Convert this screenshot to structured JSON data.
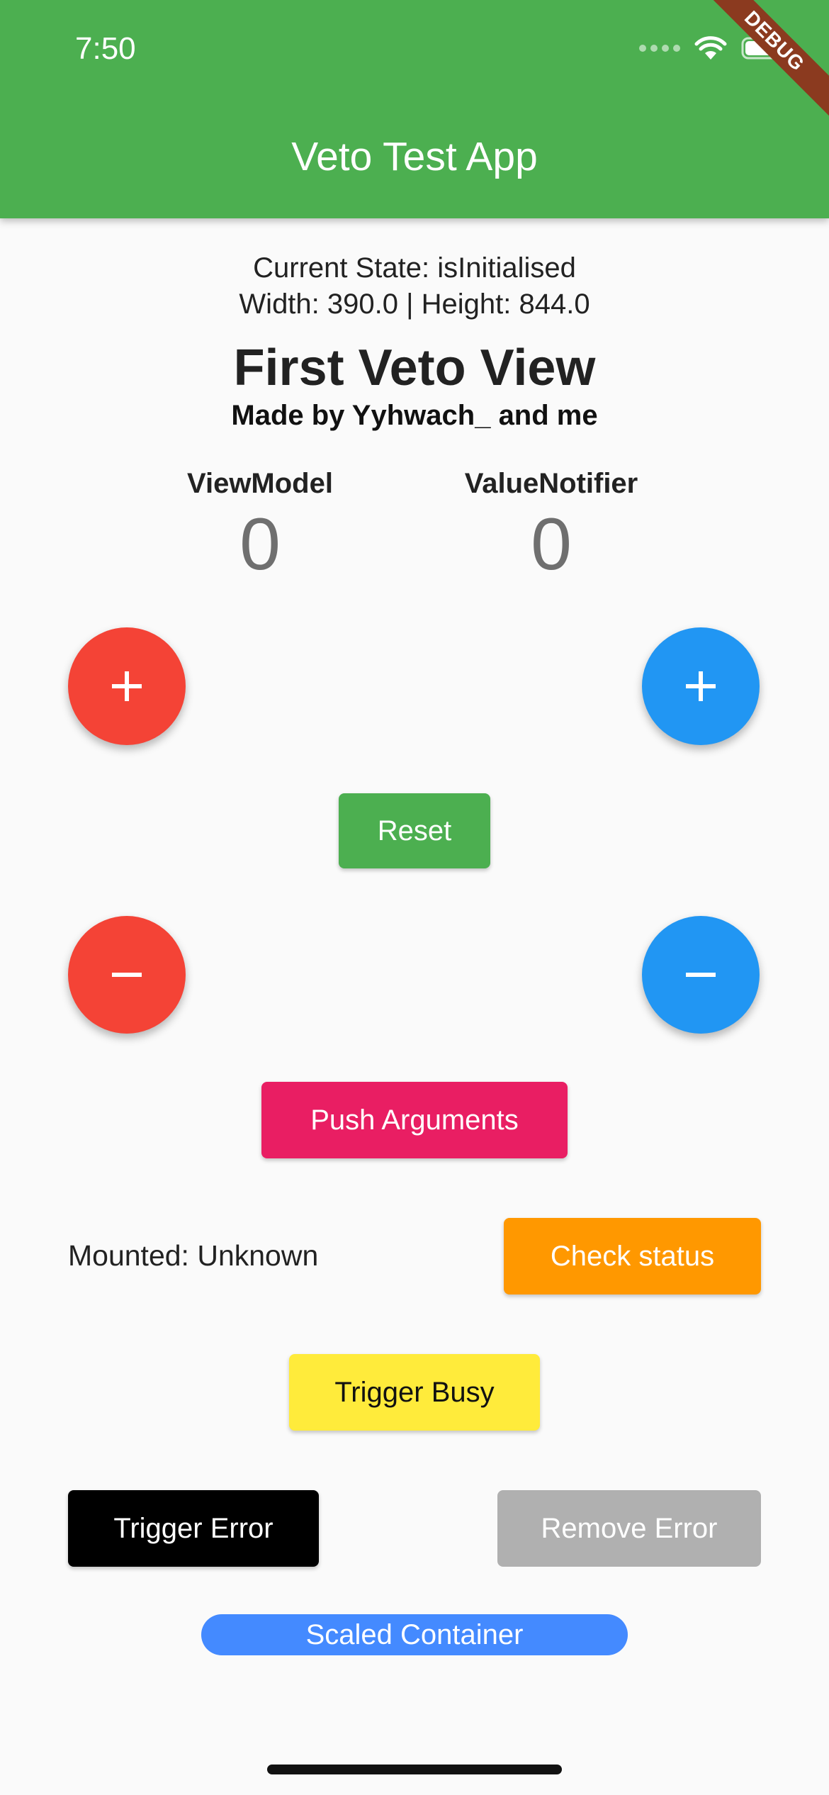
{
  "status_bar": {
    "time": "7:50"
  },
  "app_bar": {
    "title": "Veto Test App",
    "debug_banner": "DEBUG"
  },
  "info": {
    "state_line": "Current State: isInitialised",
    "size_line": "Width: 390.0 | Height: 844.0"
  },
  "view": {
    "title": "First Veto View",
    "subtitle": "Made by Yyhwach_ and me"
  },
  "counters": [
    {
      "label": "ViewModel",
      "value": "0"
    },
    {
      "label": "ValueNotifier",
      "value": "0"
    }
  ],
  "fab_icons": {
    "increment": "plus-icon",
    "decrement": "minus-icon"
  },
  "buttons": {
    "reset": "Reset",
    "push_arguments": "Push Arguments",
    "check_status": "Check status",
    "trigger_busy": "Trigger Busy",
    "trigger_error": "Trigger Error",
    "remove_error": "Remove Error"
  },
  "mounted_status": "Mounted: Unknown",
  "scaled_container": "Scaled Container",
  "colors": {
    "app_bar": "#4caf50",
    "view_model_fab": "#f44336",
    "value_notifier_fab": "#2196f3",
    "reset": "#4caf50",
    "push_arguments": "#e91e63",
    "check_status": "#ff9800",
    "trigger_busy": "#ffeb3b",
    "trigger_error": "#000000",
    "remove_error": "#b0b0b0",
    "scaled_container": "#448aff"
  }
}
